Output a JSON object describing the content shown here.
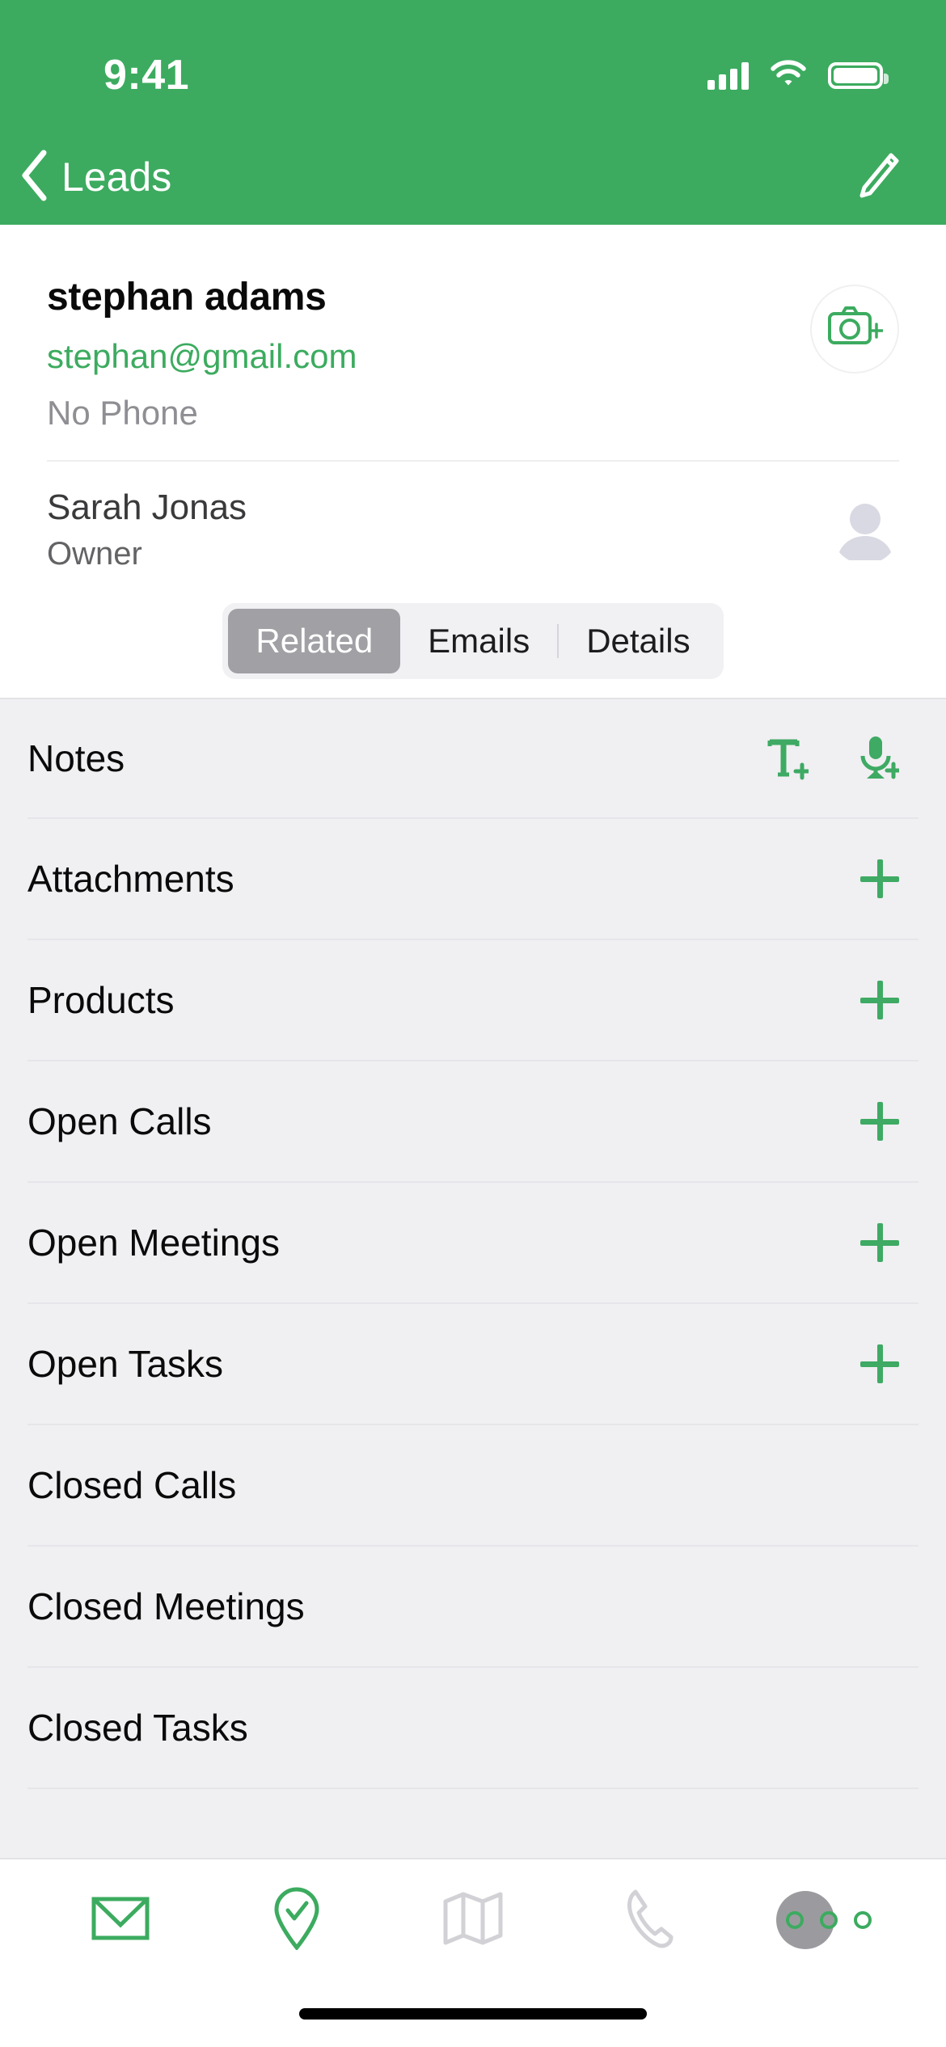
{
  "status_bar": {
    "time": "9:41",
    "signal_icon": "cellular-signal-icon",
    "wifi_icon": "wifi-icon",
    "battery_icon": "battery-full-icon"
  },
  "nav_bar": {
    "back_icon": "chevron-left-icon",
    "back_label": "Leads",
    "edit_icon": "pencil-edit-icon",
    "background_color": "#3CAB5F"
  },
  "contact": {
    "name": "stephan adams",
    "email": "stephan@gmail.com",
    "phone": "No Phone",
    "add_photo_icon": "camera-add-icon",
    "email_color": "#3CAB5F",
    "phone_color": "#8E8E93"
  },
  "owner": {
    "name": "Sarah Jonas",
    "role": "Owner",
    "avatar_icon": "person-avatar-icon"
  },
  "segmented_control": {
    "selected": "Related",
    "items": [
      {
        "label": "Related",
        "active": true
      },
      {
        "label": "Emails",
        "active": false
      },
      {
        "label": "Details",
        "active": false
      }
    ],
    "active_background": "#A0A0A5",
    "track_background": "#F1F0F3"
  },
  "related_list": {
    "background_color": "#F0EFF2",
    "accent_color": "#3EAA63",
    "rows": [
      {
        "label": "Notes",
        "actions": [
          "add-text-note-icon",
          "add-voice-note-icon"
        ]
      },
      {
        "label": "Attachments",
        "actions": [
          "plus-icon"
        ]
      },
      {
        "label": "Products",
        "actions": [
          "plus-icon"
        ]
      },
      {
        "label": "Open Calls",
        "actions": [
          "plus-icon"
        ]
      },
      {
        "label": "Open Meetings",
        "actions": [
          "plus-icon"
        ]
      },
      {
        "label": "Open Tasks",
        "actions": [
          "plus-icon"
        ]
      },
      {
        "label": "Closed Calls",
        "actions": []
      },
      {
        "label": "Closed Meetings",
        "actions": []
      },
      {
        "label": "Closed Tasks",
        "actions": []
      }
    ]
  },
  "tab_bar": {
    "tabs": [
      {
        "icon": "envelope-icon",
        "active": true
      },
      {
        "icon": "location-pin-check-icon",
        "active": true
      },
      {
        "icon": "map-icon",
        "active": false
      },
      {
        "icon": "phone-icon",
        "active": false
      },
      {
        "icon": "more-ellipsis-icon",
        "active": true
      }
    ],
    "active_color": "#3CAB5F",
    "inactive_color": "#D2D1D6"
  },
  "home_indicator": {
    "icon": "home-indicator-bar"
  }
}
